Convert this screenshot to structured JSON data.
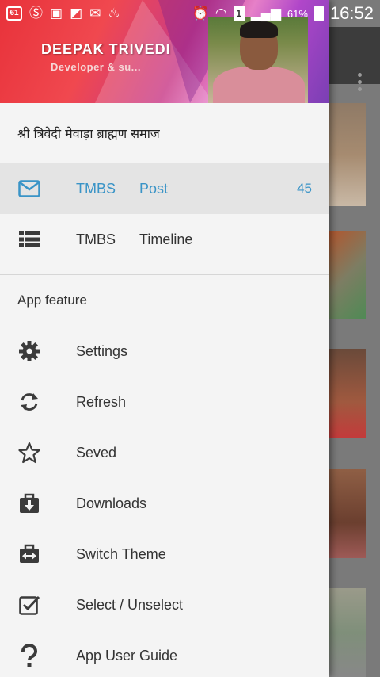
{
  "status_bar": {
    "left_badge": "61",
    "battery_pct": "61%",
    "sim": "1",
    "time": "16:52"
  },
  "header": {
    "name": "DEEPAK TRIVEDI",
    "subtitle": "Developer & su..."
  },
  "org_title": "श्री त्रिवेदी मेवाड़ा ब्राह्मण समाज",
  "nav": [
    {
      "label": "TMBS",
      "label2": "Post",
      "count": "45",
      "icon": "mail-icon",
      "active": true
    },
    {
      "label": "TMBS",
      "label2": "Timeline",
      "icon": "list-icon",
      "active": false
    }
  ],
  "section_title": "App feature",
  "features": [
    {
      "label": "Settings",
      "icon": "gear-icon"
    },
    {
      "label": "Refresh",
      "icon": "refresh-icon"
    },
    {
      "label": "Seved",
      "icon": "star-icon"
    },
    {
      "label": "Downloads",
      "icon": "download-icon"
    },
    {
      "label": "Switch Theme",
      "icon": "switch-theme-icon"
    },
    {
      "label": "Select / Unselect",
      "icon": "checkbox-icon"
    },
    {
      "label": "App User Guide",
      "icon": "help-icon"
    }
  ],
  "colors": {
    "accent": "#3a94c7",
    "drawer_bg": "#f4f4f4",
    "active_bg": "#e4e4e4"
  }
}
